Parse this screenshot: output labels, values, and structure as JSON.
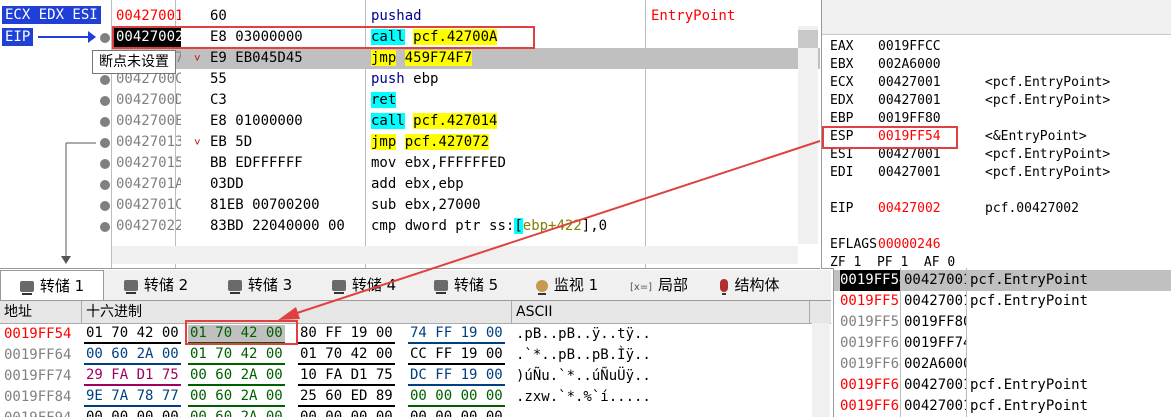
{
  "colors": {
    "accent": "#1f3fd6",
    "red": "#ff0000",
    "cyan": "#00ffff",
    "yellow": "#ffff00",
    "selection": "#c0c0c0"
  },
  "regstrip": {
    "top_tag": "ECX EDX ESI",
    "eip_tag": "EIP"
  },
  "tooltip": {
    "text": "断点未设置"
  },
  "disasm": {
    "rows": [
      {
        "addr": "00427001",
        "bytes": "60",
        "mnem": "pushad",
        "ops": "",
        "comment": "EntryPoint",
        "addr_style": "hot"
      },
      {
        "addr": "00427002",
        "bytes": "E8 03000000",
        "mnem": "call",
        "ops": "pcf.42700A",
        "comment": "",
        "addr_style": "cur"
      },
      {
        "addr": "00427007",
        "bytes": "E9 EB045D45",
        "mnem": "jmp",
        "ops": "459F74F7",
        "comment": "",
        "addr_style": ""
      },
      {
        "addr": "0042700C",
        "bytes": "55",
        "mnem": "push",
        "ops": "ebp",
        "comment": "",
        "addr_style": ""
      },
      {
        "addr": "0042700D",
        "bytes": "C3",
        "mnem": "ret",
        "ops": "",
        "comment": "",
        "addr_style": ""
      },
      {
        "addr": "0042700E",
        "bytes": "E8 01000000",
        "mnem": "call",
        "ops": "pcf.427014",
        "comment": "",
        "addr_style": ""
      },
      {
        "addr": "00427013",
        "bytes": "EB 5D",
        "mnem": "jmp",
        "ops": "pcf.427072",
        "comment": "",
        "addr_style": ""
      },
      {
        "addr": "00427015",
        "bytes": "BB EDFFFFFF",
        "mnem": "mov",
        "ops": "ebx,FFFFFFED",
        "comment": "",
        "addr_style": ""
      },
      {
        "addr": "0042701A",
        "bytes": "03DD",
        "mnem": "add",
        "ops": "ebx,ebp",
        "comment": "",
        "addr_style": ""
      },
      {
        "addr": "0042701C",
        "bytes": "81EB 00700200",
        "mnem": "sub",
        "ops": "ebx,27000",
        "comment": "",
        "addr_style": ""
      },
      {
        "addr": "00427022",
        "bytes": "83BD 22040000 00",
        "mnem": "cmp",
        "ops_pre": "dword ptr ",
        "ops_seg": "ss:",
        "ops_br": "[",
        "ops_reg": "ebp+422",
        "ops_post": "],0",
        "comment": "",
        "addr_style": ""
      }
    ]
  },
  "registers": [
    {
      "name": "EAX",
      "value": "0019FFCC",
      "comment": "",
      "hot": false
    },
    {
      "name": "EBX",
      "value": "002A6000",
      "comment": "",
      "hot": false
    },
    {
      "name": "ECX",
      "value": "00427001",
      "comment": "<pcf.EntryPoint>",
      "hot": false
    },
    {
      "name": "EDX",
      "value": "00427001",
      "comment": "<pcf.EntryPoint>",
      "hot": false
    },
    {
      "name": "EBP",
      "value": "0019FF80",
      "comment": "",
      "hot": false
    },
    {
      "name": "ESP",
      "value": "0019FF54",
      "comment": "<&EntryPoint>",
      "hot": true
    },
    {
      "name": "ESI",
      "value": "00427001",
      "comment": "<pcf.EntryPoint>",
      "hot": false
    },
    {
      "name": "EDI",
      "value": "00427001",
      "comment": "<pcf.EntryPoint>",
      "hot": false
    },
    {
      "name": "",
      "value": "",
      "comment": "",
      "hot": false
    },
    {
      "name": "EIP",
      "value": "00427002",
      "comment": "pcf.00427002",
      "hot": true
    },
    {
      "name": "",
      "value": "",
      "comment": "",
      "hot": false
    },
    {
      "name": "EFLAGS",
      "value": "00000246",
      "comment": "",
      "hot": true
    },
    {
      "name": "ZF 1  PF 1  AF 0",
      "value": "",
      "comment": "",
      "hot": false
    }
  ],
  "dump_tabs": [
    {
      "label": "转储 1",
      "active": true,
      "icon": "dump-icon"
    },
    {
      "label": "转储 2",
      "active": false,
      "icon": "dump-icon"
    },
    {
      "label": "转储 3",
      "active": false,
      "icon": "dump-icon"
    },
    {
      "label": "转储 4",
      "active": false,
      "icon": "dump-icon"
    },
    {
      "label": "转储 5",
      "active": false,
      "icon": "dump-icon"
    },
    {
      "label": "监视 1",
      "active": false,
      "icon": "watch-icon"
    },
    {
      "label": "局部",
      "active": false,
      "icon": "locals-icon",
      "icon_text": "[x=]"
    },
    {
      "label": "结构体",
      "active": false,
      "icon": "struct-icon"
    }
  ],
  "dump": {
    "headers": {
      "address": "地址",
      "hex": "十六进制",
      "ascii": "ASCII"
    },
    "rows": [
      {
        "addr": "0019FF54",
        "hot": true,
        "groups": [
          "01 70 42 00",
          "01 70 42 00",
          "80 FF 19 00",
          "74 FF 19 00"
        ],
        "ascii": ".pB..pB..ÿ..tÿ.."
      },
      {
        "addr": "0019FF64",
        "hot": false,
        "groups": [
          "00 60 2A 00",
          "01 70 42 00",
          "01 70 42 00",
          "CC FF 19 00"
        ],
        "ascii": ".`*..pB..pB.Ìÿ.."
      },
      {
        "addr": "0019FF74",
        "hot": false,
        "groups": [
          "29 FA D1 75",
          "00 60 2A 00",
          "10 FA D1 75",
          "DC FF 19 00"
        ],
        "ascii": ")úÑu.`*..úÑuÜÿ.."
      },
      {
        "addr": "0019FF84",
        "hot": false,
        "groups": [
          "9E 7A 78 77",
          "00 60 2A 00",
          "25 60 ED 89",
          "00 00 00 00"
        ],
        "ascii": ".zxw.`*.%`í....."
      },
      {
        "addr": "0019FF94",
        "hot": false,
        "groups": [
          "00 00 00 00",
          "00 60 2A 00",
          "00 00 00 00",
          "00 00 00 00"
        ],
        "ascii": ""
      }
    ]
  },
  "stack": [
    {
      "addr": "0019FF54",
      "value": "00427001",
      "comment": "pcf.EntryPoint",
      "style": "top"
    },
    {
      "addr": "0019FF58",
      "value": "00427001",
      "comment": "pcf.EntryPoint",
      "style": "hot"
    },
    {
      "addr": "0019FF5C",
      "value": "0019FF80",
      "comment": "",
      "style": ""
    },
    {
      "addr": "0019FF60",
      "value": "0019FF74",
      "comment": "",
      "style": ""
    },
    {
      "addr": "0019FF64",
      "value": "002A6000",
      "comment": "",
      "style": ""
    },
    {
      "addr": "0019FF68",
      "value": "00427001",
      "comment": "pcf.EntryPoint",
      "style": "hot"
    },
    {
      "addr": "0019FF6C",
      "value": "00427001",
      "comment": "pcf.EntryPoint",
      "style": "hot"
    }
  ]
}
